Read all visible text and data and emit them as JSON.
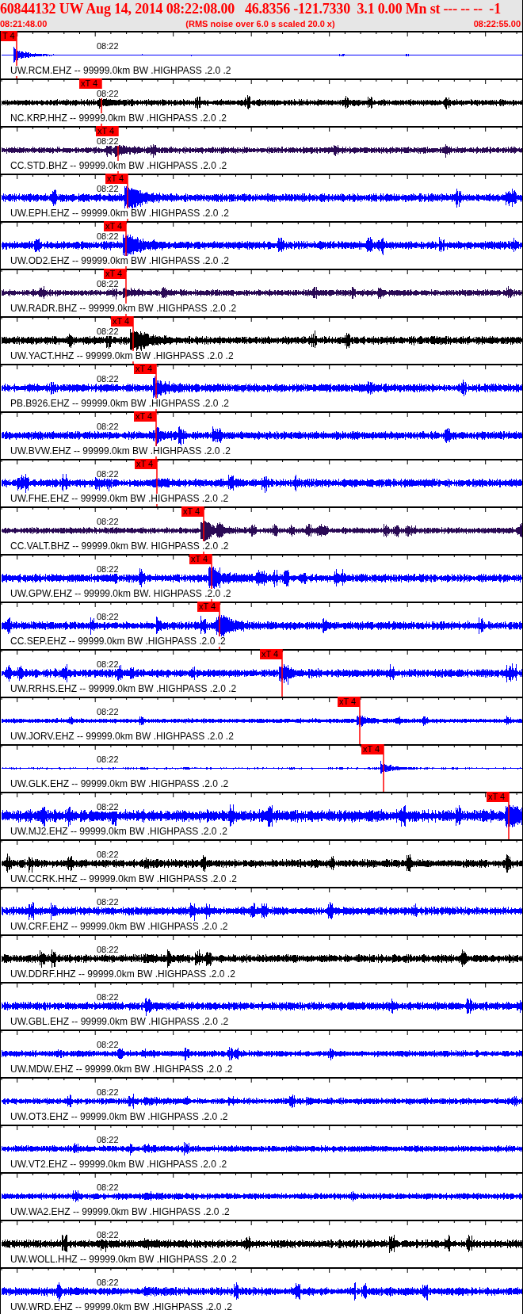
{
  "header": {
    "title": "60844132 UW Aug 14, 2014 08:22:08.00   46.8356 -121.7330  3.1 0.00 Mn st --- -- --  -1",
    "start_time": "08:21:48.00",
    "note": "(RMS noise over 6.0 s scaled 20.0 x)",
    "end_time": "08:22:55.00"
  },
  "traces": [
    {
      "label": "UW.RCM.EHZ -- 99999.0km BW .HIGHPASS .2.0 .2",
      "time": "08:22",
      "pick": "T 4",
      "color": "#0000ff"
    },
    {
      "label": "NC.KRP.HHZ -- 99999.0km BW .HIGHPASS .2.0 .2",
      "time": "08:22",
      "pick": "xT 4",
      "color": "#000000"
    },
    {
      "label": "CC.STD.BHZ -- 99999.0km BW .HIGHPASS .2.0 .2",
      "time": "08:22",
      "pick": "xT 4",
      "color": "#2a0a55"
    },
    {
      "label": "UW.EPH.EHZ -- 99999.0km BW .HIGHPASS .2.0 .2",
      "time": "08:22",
      "pick": "xT 4",
      "color": "#0000ff"
    },
    {
      "label": "UW.OD2.EHZ -- 99999.0km BW .HIGHPASS .2.0 .2",
      "time": "08:22",
      "pick": "xT 4",
      "color": "#0000ff"
    },
    {
      "label": "UW.RADR.BHZ -- 99999.0km BW .HIGHPASS .2.0 .2",
      "time": "08:22",
      "pick": "xT 4",
      "color": "#2a0a55"
    },
    {
      "label": "UW.YACT.HHZ -- 99999.0km BW .HIGHPASS .2.0 .2",
      "time": "08:22",
      "pick": "xT 4",
      "color": "#000000"
    },
    {
      "label": "PB.B926.EHZ -- 99999.0km BW .HIGHPASS .2.0 .2",
      "time": "08:22",
      "pick": "xT 4",
      "color": "#0000ff"
    },
    {
      "label": "UW.BVW.EHZ -- 99999.0km BW .HIGHPASS .2.0 .2",
      "time": "08:22",
      "pick": "xT 4",
      "color": "#0000ff"
    },
    {
      "label": "UW.FHE.EHZ -- 99999.0km BW .HIGHPASS .2.0 .2",
      "time": "08:22",
      "pick": "xT 4",
      "color": "#0000ff"
    },
    {
      "label": "CC.VALT.BHZ -- 99999.0km BW. HIGHPASS .2.0 .2",
      "time": "08:22",
      "pick": "xT 4",
      "color": "#2a0a55"
    },
    {
      "label": "UW.GPW.EHZ -- 99999.0km BW. HIGHPASS .2.0 .2",
      "time": "08:22",
      "pick": "xT 4",
      "color": "#0000ff"
    },
    {
      "label": "CC.SEP.EHZ -- 99999.0km BW .HIGHPASS .2.0 .2",
      "time": "08:22",
      "pick": "xT 4",
      "color": "#0000ff"
    },
    {
      "label": "UW.RRHS.EHZ -- 99999.0km BW .HIGHPASS .2.0 .2",
      "time": "08:22",
      "pick": "xT 4",
      "color": "#0000ff"
    },
    {
      "label": "UW.JORV.EHZ -- 99999.0km BW .HIGHPASS .2.0 .2",
      "time": "08:22",
      "pick": "xT 4",
      "color": "#0000ff"
    },
    {
      "label": "UW.GLK.EHZ -- 99999.0km BW .HIGHPASS .2.0 .2",
      "time": "08:22",
      "pick": "xT 4",
      "color": "#0000ff"
    },
    {
      "label": "UW.MJ2.EHZ -- 99999.0km BW .HIGHPASS .2.0 .2",
      "time": "08:22",
      "pick": "xT 4",
      "color": "#0000ff"
    },
    {
      "label": "UW.CCRK.HHZ -- 99999.0km BW .HIGHPASS .2.0 .2",
      "time": "08:22",
      "color": "#000000"
    },
    {
      "label": "UW.CRF.EHZ -- 99999.0km BW .HIGHPASS .2.0 .2",
      "time": "08:22",
      "color": "#0000ff"
    },
    {
      "label": "UW.DDRF.HHZ -- 99999.0km BW .HIGHPASS .2.0 .2",
      "time": "08:22",
      "color": "#000000"
    },
    {
      "label": "UW.GBL.EHZ -- 99999.0km BW .HIGHPASS .2.0 .2",
      "time": "08:22",
      "color": "#0000ff"
    },
    {
      "label": "UW.MDW.EHZ -- 99999.0km BW .HIGHPASS .2.0 .2",
      "time": "08:22",
      "color": "#0000ff"
    },
    {
      "label": "UW.OT3.EHZ -- 99999.0km BW .HIGHPASS .2.0 .2",
      "time": "08:22",
      "color": "#0000ff"
    },
    {
      "label": "UW.VT2.EHZ -- 99999.0km BW .HIGHPASS .2.0 .2",
      "time": "08:22",
      "color": "#0000ff"
    },
    {
      "label": "UW.WA2.EHZ -- 99999.0km BW .HIGHPASS .2.0 .2",
      "time": "08:22",
      "color": "#0000ff"
    },
    {
      "label": "UW.WOLL.HHZ -- 99999.0km BW .HIGHPASS .2.0 .2",
      "time": "08:22",
      "color": "#000000"
    },
    {
      "label": "UW.WRD.EHZ -- 99999.0km BW .HIGHPASS .2.0 .2",
      "time": "08:22",
      "color": "#0000ff"
    }
  ]
}
